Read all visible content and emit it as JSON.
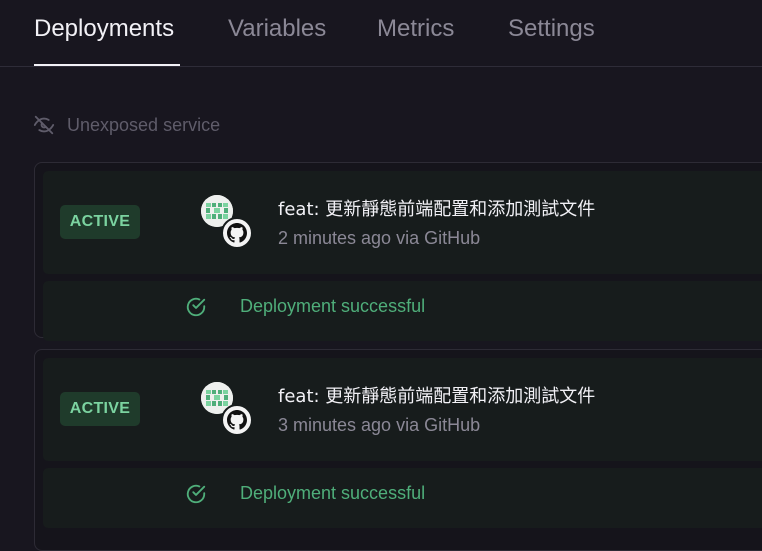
{
  "tabs": [
    {
      "label": "Deployments",
      "active": true
    },
    {
      "label": "Variables",
      "active": false
    },
    {
      "label": "Metrics",
      "active": false
    },
    {
      "label": "Settings",
      "active": false
    }
  ],
  "service": {
    "exposure_icon": "eye-off-icon",
    "exposure_text": "Unexposed service"
  },
  "deployments": [
    {
      "status": "ACTIVE",
      "commit_message": "feat: 更新靜態前端配置和添加測試文件",
      "meta": "2 minutes ago via GitHub",
      "result": "Deployment successful"
    },
    {
      "status": "ACTIVE",
      "commit_message": "feat: 更新靜態前端配置和添加測試文件",
      "meta": "3 minutes ago via GitHub",
      "result": "Deployment successful"
    }
  ],
  "colors": {
    "background": "#18161f",
    "badge_bg": "#1f3b2b",
    "badge_text": "#7bd3a0",
    "success": "#4fae7a"
  }
}
